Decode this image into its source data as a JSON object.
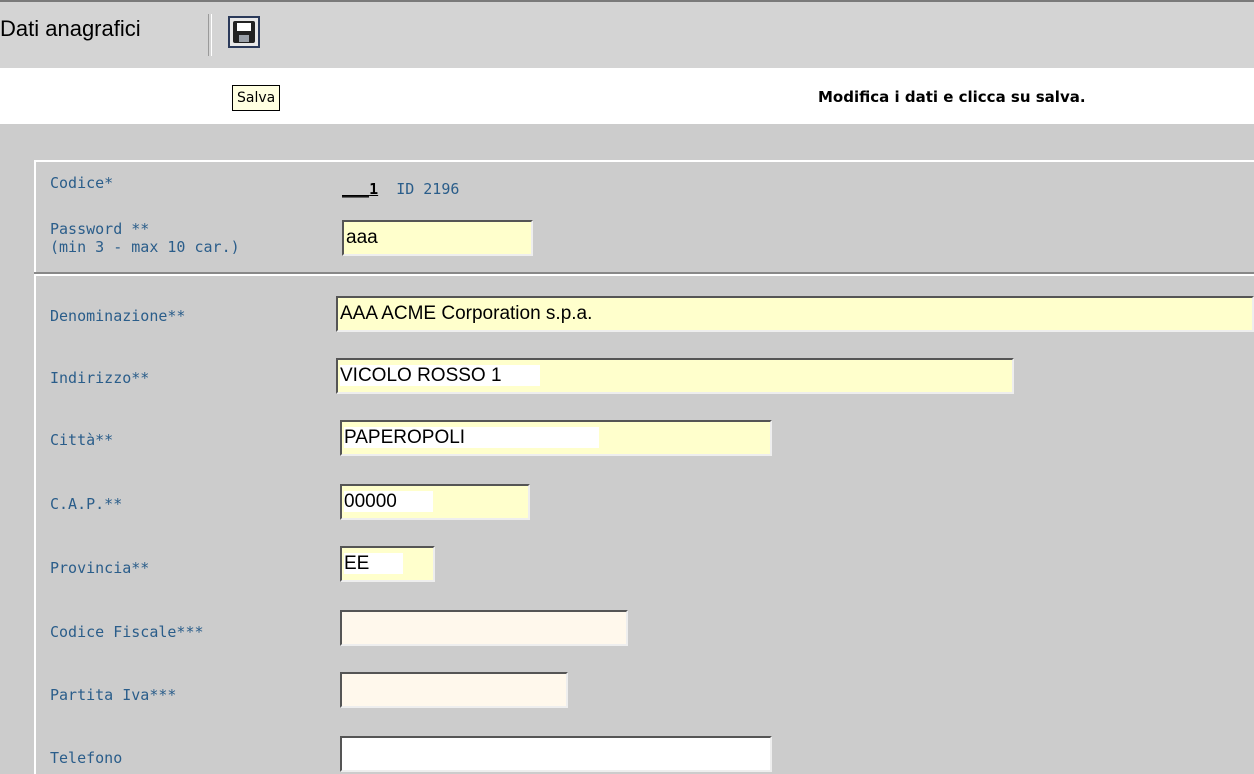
{
  "toolbar": {
    "title": "Dati anagrafici",
    "save_tooltip": "Salva"
  },
  "instruction": "Modifica i dati e clicca su salva.",
  "codice": {
    "label": "Codice*",
    "value_prefix": "___",
    "value": "1",
    "id_text": "ID  2196"
  },
  "password": {
    "label_line1": "Password **",
    "label_line2": "(min 3 - max 10 car.)",
    "value": "aaa"
  },
  "fields": {
    "denominazione": {
      "label": "Denominazione**",
      "value": "AAA ACME Corporation s.p.a."
    },
    "indirizzo": {
      "label": "Indirizzo**",
      "value": "VICOLO ROSSO 1"
    },
    "citta": {
      "label": "Città**",
      "value": "PAPEROPOLI"
    },
    "cap": {
      "label": "C.A.P.**",
      "value": "00000"
    },
    "provincia": {
      "label": "Provincia**",
      "value": "EE"
    },
    "codice_fiscale": {
      "label": "Codice Fiscale***",
      "value": ""
    },
    "partita_iva": {
      "label": "Partita Iva***",
      "value": ""
    },
    "telefono": {
      "label": "Telefono",
      "value": ""
    }
  },
  "icons": {
    "save": "floppy-disk-icon"
  }
}
